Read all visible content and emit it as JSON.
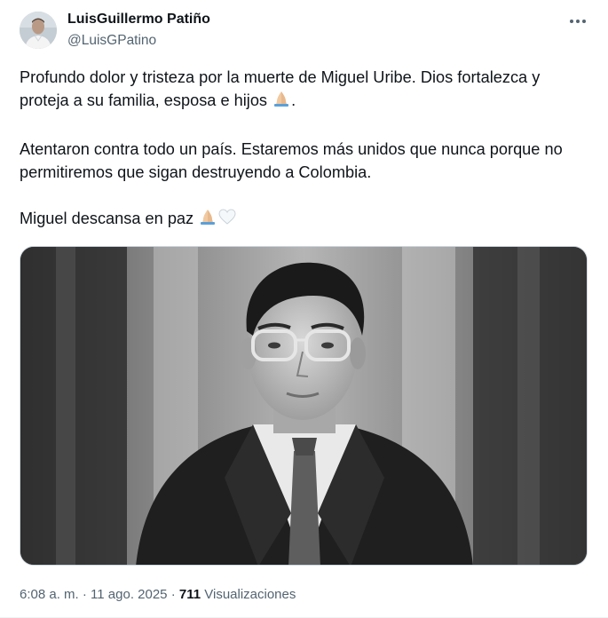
{
  "author": {
    "display_name": "LuisGuillermo Patiño",
    "handle": "@LuisGPatino"
  },
  "icons": {
    "more": "more-horizontal-icon",
    "avatar": "avatar-photo",
    "emoji_pray": "folded-hands-emoji",
    "emoji_heart": "white-heart-emoji"
  },
  "tweet": {
    "paragraph_1": "Profundo dolor y tristeza por la muerte de Miguel Uribe. Dios fortalezca y proteja a su familia, esposa e hijos",
    "paragraph_1_end": ".",
    "paragraph_2": "Atentaron contra todo un país. Estaremos más unidos que nunca porque no permitiremos que sigan destruyendo a Colombia.",
    "paragraph_3": "Miguel descansa en paz"
  },
  "meta": {
    "time": "6:08 a. m.",
    "separator": "·",
    "date": "11 ago. 2025",
    "views_count": "711",
    "views_label": "Visualizaciones"
  },
  "colors": {
    "text_primary": "#0f1419",
    "text_secondary": "#536471",
    "border": "#cfd9de"
  }
}
